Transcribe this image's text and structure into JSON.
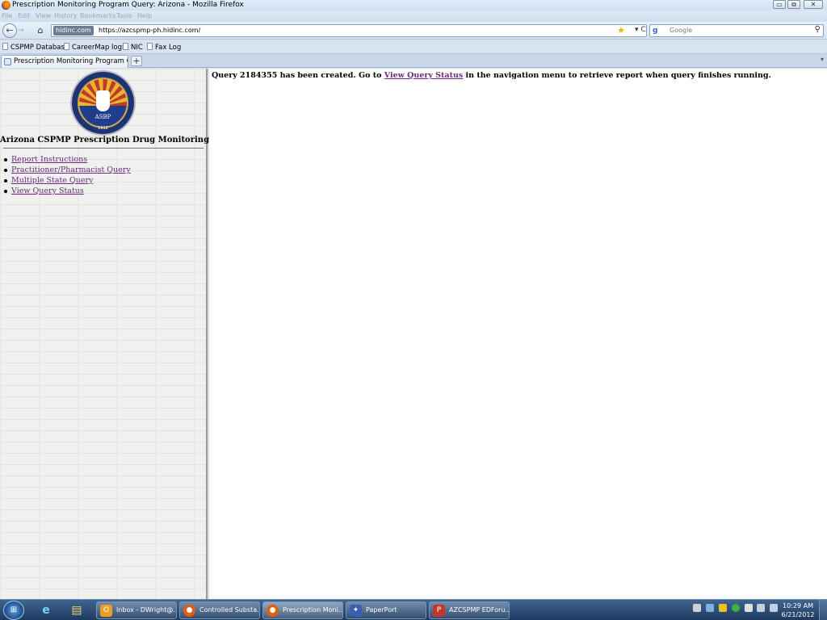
{
  "window": {
    "title": "Prescription Monitoring Program Query: Arizona - Mozilla Firefox",
    "minimize": "▭",
    "maximize": "⧉",
    "close": "✕"
  },
  "menubar": [
    "File",
    "Edit",
    "View",
    "History",
    "Bookmarks",
    "Tools",
    "Help"
  ],
  "navbar": {
    "back": "←",
    "forward": "→",
    "home": "⌂",
    "site_badge": "hidinc.com",
    "url": "https://azcspmp-ph.hidinc.com/",
    "star": "★",
    "reload": "▾ C",
    "search_engine_icon": "g",
    "search_placeholder": "Google",
    "search_icon": "⚲"
  },
  "bookmarks": [
    "CSPMP Database",
    "CareerMap login",
    "NIC",
    "Fax Log"
  ],
  "tabs": {
    "active": "Prescription Monitoring Program Query:...",
    "new_tab": "+",
    "menu": "▾"
  },
  "sidebar": {
    "seal_abbr": "ASBP",
    "seal_year": "1912",
    "menu_title": "Arizona CSPMP  Prescription Drug Monitoring Menu",
    "items": [
      {
        "label": "Report Instructions"
      },
      {
        "label": "Practitioner/Pharmacist Query"
      },
      {
        "label": "Multiple State Query"
      },
      {
        "label": "View Query Status"
      }
    ]
  },
  "main": {
    "message_prefix": "Query 2184355 has been created. Go to ",
    "message_link": "View Query Status",
    "message_suffix": " in the navigation menu to retrieve report when query finishes running."
  },
  "taskbar": {
    "start": "⊞",
    "pinned": [
      {
        "name": "internet-explorer",
        "glyph": "e"
      },
      {
        "name": "explorer",
        "glyph": "▤"
      }
    ],
    "tasks": [
      {
        "label": "Inbox - DWright@...",
        "glyph": "O",
        "color": "#e8a020"
      },
      {
        "label": "Controlled Substa...",
        "glyph": "●",
        "color": "#e06010"
      },
      {
        "label": "Prescription Moni...",
        "glyph": "●",
        "color": "#e06010"
      },
      {
        "label": "PaperPort",
        "glyph": "✦",
        "color": "#3a5fb0"
      },
      {
        "label": "AZCSPMP EDForu...",
        "glyph": "P",
        "color": "#c0392b"
      }
    ],
    "clock_time": "10:29 AM",
    "clock_date": "6/21/2012"
  }
}
